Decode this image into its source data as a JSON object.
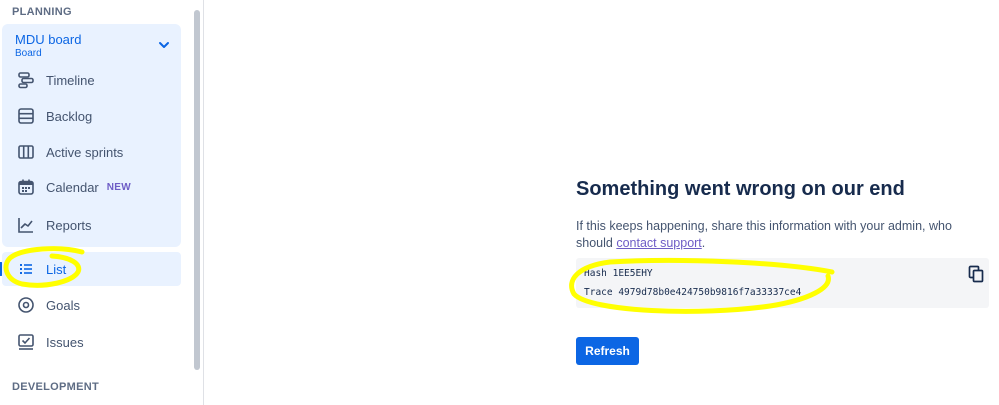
{
  "sidebar": {
    "planning_label": "PLANNING",
    "board": {
      "title": "MDU board",
      "subtitle": "Board"
    },
    "items": [
      {
        "label": "Timeline",
        "icon": "timeline-icon"
      },
      {
        "label": "Backlog",
        "icon": "backlog-icon"
      },
      {
        "label": "Active sprints",
        "icon": "board-columns-icon"
      },
      {
        "label": "Calendar",
        "icon": "calendar-icon",
        "badge": "NEW"
      },
      {
        "label": "Reports",
        "icon": "reports-chart-icon"
      },
      {
        "label": "List",
        "icon": "list-icon",
        "selected": true
      },
      {
        "label": "Goals",
        "icon": "goals-target-icon"
      },
      {
        "label": "Issues",
        "icon": "issues-icon"
      }
    ],
    "development_label": "DEVELOPMENT"
  },
  "error": {
    "title": "Something went wrong on our end",
    "text_before_link": "If this keeps happening, share this information with your admin, who should ",
    "link": "contact support",
    "text_after_link": ".",
    "hash_line": "Hash 1EE5EHY",
    "trace_line": "Trace 4979d78b0e424750b9816f7a33337ce4",
    "refresh_label": "Refresh"
  },
  "colors": {
    "accent": "#0c66e4",
    "selected_bg": "#e9f2ff",
    "badge": "#6e5dc6",
    "highlight": "#ffff00"
  }
}
